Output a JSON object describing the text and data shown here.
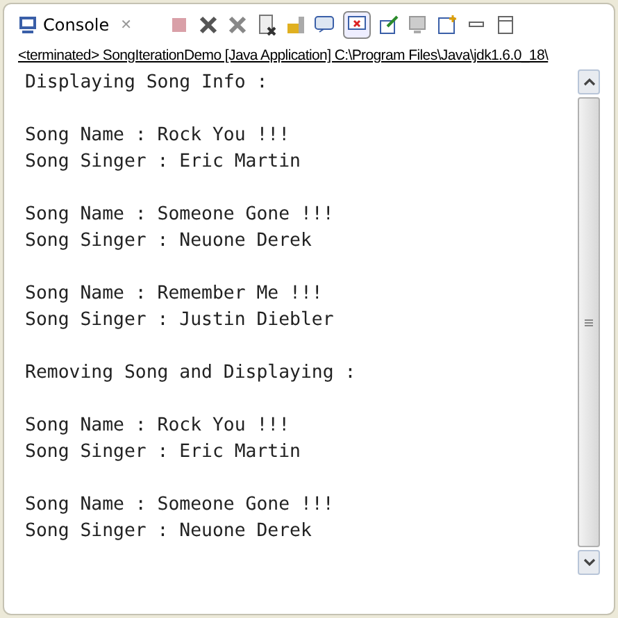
{
  "tab": {
    "label": "Console",
    "close": "✕"
  },
  "status_line": "<terminated> SongIterationDemo [Java Application] C:\\Program Files\\Java\\jdk1.6.0_18\\",
  "output_blocks": [
    [
      "Displaying Song Info :"
    ],
    [
      "Song Name : Rock You !!!",
      "Song Singer : Eric Martin"
    ],
    [
      "Song Name : Someone Gone !!!",
      "Song Singer : Neuone Derek"
    ],
    [
      "Song Name : Remember Me !!!",
      "Song Singer : Justin Diebler"
    ],
    [
      "Removing Song and Displaying :"
    ],
    [
      "Song Name : Rock You !!!",
      "Song Singer : Eric Martin"
    ],
    [
      "Song Name : Someone Gone !!!",
      "Song Singer : Neuone Derek"
    ]
  ]
}
